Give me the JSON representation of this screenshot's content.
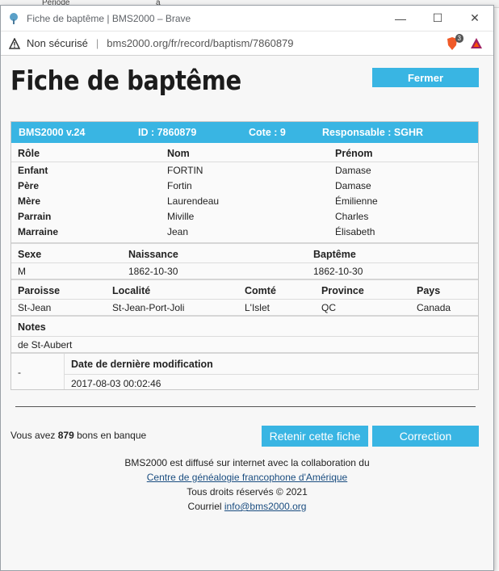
{
  "background": {
    "text1": "Période",
    "text2": "à"
  },
  "window": {
    "title": "Fiche de baptême | BMS2000 – Brave",
    "controls": {
      "minimize": "—",
      "maximize": "☐",
      "close": "✕"
    }
  },
  "address": {
    "security_label": "Non sécurisé",
    "separator": "|",
    "url": "bms2000.org/fr/record/baptism/7860879",
    "shield_badge": "3"
  },
  "page": {
    "title": "Fiche de baptême",
    "close_label": "Fermer"
  },
  "record": {
    "header": {
      "version": "BMS2000 v.24",
      "id": "ID : 7860879",
      "cote": "Cote : 9",
      "responsable": "Responsable : SGHR"
    },
    "people_headers": [
      "Rôle",
      "Nom",
      "Prénom"
    ],
    "people": [
      {
        "role": "Enfant",
        "nom": "FORTIN",
        "prenom": "Damase"
      },
      {
        "role": "Père",
        "nom": "Fortin",
        "prenom": "Damase"
      },
      {
        "role": "Mère",
        "nom": "Laurendeau",
        "prenom": "Émilienne"
      },
      {
        "role": "Parrain",
        "nom": "Miville",
        "prenom": "Charles"
      },
      {
        "role": "Marraine",
        "nom": "Jean",
        "prenom": "Élisabeth"
      }
    ],
    "event_headers": [
      "Sexe",
      "Naissance",
      "Baptême"
    ],
    "event": {
      "sexe": "M",
      "naissance": "1862-10-30",
      "bapteme": "1862-10-30"
    },
    "place_headers": [
      "Paroisse",
      "Localité",
      "Comté",
      "Province",
      "Pays"
    ],
    "place": {
      "paroisse": "St-Jean",
      "localite": "St-Jean-Port-Joli",
      "comte": "L'Islet",
      "province": "QC",
      "pays": "Canada"
    },
    "notes_header": "Notes",
    "notes": "de St-Aubert",
    "mod_left": "-",
    "mod_header": "Date de dernière modification",
    "mod_value": "2017-08-03 00:02:46"
  },
  "actions": {
    "balance_prefix": "Vous avez",
    "balance_count": "879",
    "balance_suffix": "bons en banque",
    "keep_label": "Retenir cette fiche",
    "correction_label": "Correction"
  },
  "footer": {
    "line1": "BMS2000 est diffusé sur internet avec la collaboration du",
    "link1": "Centre de généalogie francophone d'Amérique",
    "line3": "Tous droits réservés © 2021",
    "contact_prefix": "Courriel",
    "email": "info@bms2000.org"
  },
  "colors": {
    "accent": "#39b5e3",
    "link": "#1a4d80"
  }
}
